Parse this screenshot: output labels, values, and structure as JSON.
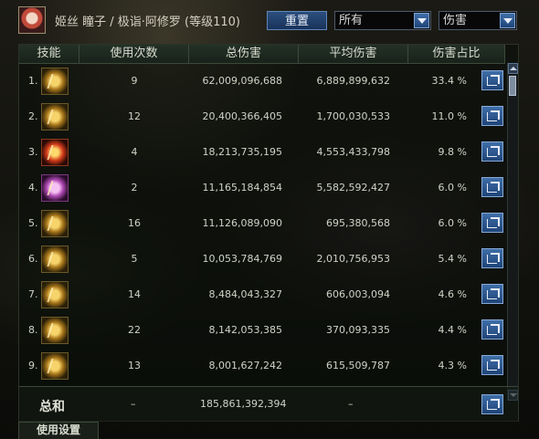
{
  "header": {
    "title": "姬丝 瞳子 / 极诣·阿修罗 (等级110)",
    "reset_label": "重置",
    "filter_select": "所有",
    "metric_select": "伤害"
  },
  "table": {
    "columns": [
      "技能",
      "使用次数",
      "总伤害",
      "平均伤害",
      "伤害占比"
    ],
    "rows": [
      {
        "index": "1.",
        "uses": "9",
        "total": "62,009,096,688",
        "avg": "6,889,899,632",
        "pct": "33.4 %",
        "icon": "lightning-skill-icon"
      },
      {
        "index": "2.",
        "uses": "12",
        "total": "20,400,366,405",
        "avg": "1,700,030,533",
        "pct": "11.0 %",
        "icon": "slash-skill-icon"
      },
      {
        "index": "3.",
        "uses": "4",
        "total": "18,213,735,195",
        "avg": "4,553,433,798",
        "pct": "9.8 %",
        "icon": "eye-skill-icon"
      },
      {
        "index": "4.",
        "uses": "2",
        "total": "11,165,184,854",
        "avg": "5,582,592,427",
        "pct": "6.0 %",
        "icon": "burst-skill-icon"
      },
      {
        "index": "5.",
        "uses": "16",
        "total": "11,126,089,090",
        "avg": "695,380,568",
        "pct": "6.0 %",
        "icon": "wave-skill-icon"
      },
      {
        "index": "6.",
        "uses": "5",
        "total": "10,053,784,769",
        "avg": "2,010,756,953",
        "pct": "5.4 %",
        "icon": "ring-skill-icon"
      },
      {
        "index": "7.",
        "uses": "14",
        "total": "8,484,043,327",
        "avg": "606,003,094",
        "pct": "4.6 %",
        "icon": "figure-skill-icon"
      },
      {
        "index": "8.",
        "uses": "22",
        "total": "8,142,053,385",
        "avg": "370,093,335",
        "pct": "4.4 %",
        "icon": "crescent-skill-icon"
      },
      {
        "index": "9.",
        "uses": "13",
        "total": "8,001,627,242",
        "avg": "615,509,787",
        "pct": "4.3 %",
        "icon": "vortex-skill-icon"
      }
    ],
    "total": {
      "label": "总和",
      "uses": "–",
      "sum": "185,861,392,394",
      "avg": "–"
    }
  },
  "footer": {
    "settings_label": "使用设置"
  },
  "colors": {
    "accent": "#2c4f7e",
    "header_bg": "#243126"
  }
}
